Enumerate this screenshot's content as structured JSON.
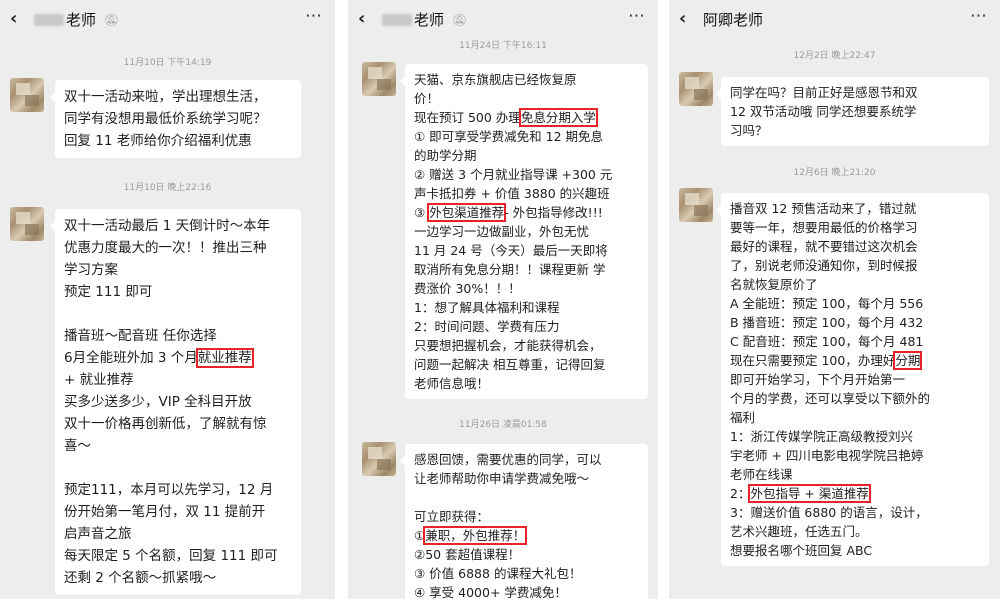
{
  "panel1": {
    "title": "老师",
    "messages": [
      {
        "time": "11月10日 下午14:19",
        "lines": [
          "双十一活动来啦，学出理想生活，",
          "同学有没想用最低价系统学习呢？",
          "回复 11 老师给你介绍福利优惠"
        ]
      },
      {
        "time": "11月10日 晚上22:16",
        "lines": [
          "双十一活动最后 1 天倒计时～本年",
          "优惠力度最大的一次！！推出三种",
          "学习方案",
          "预定 111 即可",
          "",
          "播音班～配音班 任你选择",
          "6月全能班外加 3 个月",
          "+ 就业推荐",
          "买多少送多少，VIP 全科目开放",
          "双十一价格再创新低，了解就有惊",
          "喜～",
          "",
          "预定111，本月可以先学习，12 月",
          "份开始第一笔月付，双 11 提前开",
          "启声音之旅",
          "每天限定 5 个名额，回复 111 即可",
          "还剩 2 个名额～抓紧哦～"
        ],
        "highlight": "就业推荐"
      }
    ]
  },
  "panel2": {
    "title": "老师",
    "messages": [
      {
        "time": "11月24日 下午16:11",
        "lines": [
          "天猫、京东旗舰店已经恢复原",
          "价！",
          "现在预订 500 办理",
          "① 即可享受学费减免和 12 期免息",
          "的助学分期",
          "② 赠送 3 个月就业指导课 +300 元",
          "声卡抵扣券 + 价值 3880 的兴趣班",
          "③ ",
          "一边学习一边做副业，外包无忧",
          "11 月 24 号（今天）最后一天即将",
          "取消所有免息分期！！课程更新 学",
          "费涨价 30%！！！",
          "1：想了解具体福利和课程",
          "2：时间问题、学费有压力",
          "只要想把握机会，才能获得机会，",
          "问题一起解决 相互尊重，记得回复",
          "老师信息哦！"
        ],
        "highlight1": "免息分期入学",
        "highlight2": "外包渠道推荐",
        "after2": "- 外包指导修改!!!"
      },
      {
        "time": "11月26日 凌晨01:58",
        "lines": [
          "感恩回馈，需要优惠的同学，可以",
          "让老师帮助你申请学费减免哦～",
          "",
          "可立即获得：",
          "①",
          "②50 套超值课程！",
          "③ 价值 6888 的课程大礼包！",
          "④ 享受 4000+ 学费减免！"
        ],
        "highlight": "兼职，外包推荐！"
      }
    ]
  },
  "panel3": {
    "title": "阿卿老师",
    "messages": [
      {
        "time": "12月2日 晚上22:47",
        "lines": [
          "同学在吗？目前正好是感恩节和双",
          "12 双节活动哦 同学还想要系统学",
          "习吗？"
        ]
      },
      {
        "time": "12月6日 晚上21:20",
        "lines": [
          "播音双 12 预售活动来了，错过就",
          "要等一年，想要用最低的价格学习",
          "最好的课程，就不要错过这次机会",
          "了，别说老师没通知你，到时候报",
          "名就恢复原价了",
          "A 全能班：预定 100，每个月 556",
          "B 播音班：预定 100，每个月 432",
          "C 配音班：预定 100，每个月 481",
          "现在只需要预定 100，办理好",
          "即可开始学习，下个月开始第一",
          "个月的学费，还可以享受以下额外的",
          "福利",
          "1：浙江传媒学院正高级教授刘兴",
          "宇老师 + 四川电影电视学院吕艳婷",
          "老师在线课",
          "2：",
          "3：赠送价值 6880 的语言，设计，",
          "艺术兴趣班，任选五门。",
          "想要报名哪个班回复 ABC"
        ],
        "highlight1": "分期",
        "highlight2": "外包指导 + 渠道推荐"
      }
    ]
  }
}
